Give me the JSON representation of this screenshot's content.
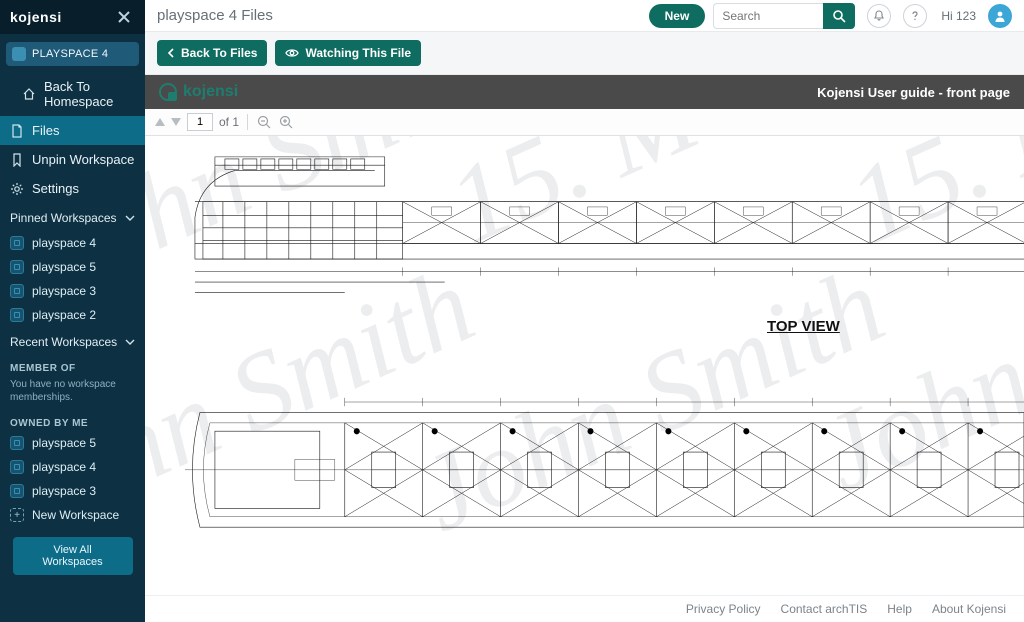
{
  "brand": "kojensi",
  "sidebar": {
    "current_workspace": "PLAYSPACE 4",
    "back_home": "Back To Homespace",
    "nav": {
      "files": "Files",
      "unpin": "Unpin Workspace",
      "settings": "Settings"
    },
    "pinned_title": "Pinned Workspaces",
    "pinned": [
      "playspace 4",
      "playspace 5",
      "playspace 3",
      "playspace 2"
    ],
    "recent_title": "Recent Workspaces",
    "member_of_title": "MEMBER OF",
    "member_note": "You have no workspace memberships.",
    "owned_title": "OWNED BY ME",
    "owned": [
      "playspace 5",
      "playspace 4",
      "playspace 3"
    ],
    "new_ws": "New Workspace",
    "view_all": "View All Workspaces"
  },
  "header": {
    "page_title": "playspace 4 Files",
    "new_label": "New",
    "search_placeholder": "Search",
    "greeting": "Hi 123"
  },
  "toolbar": {
    "back_to_files": "Back To Files",
    "watching": "Watching This File"
  },
  "viewer": {
    "logo_text": "kojensi",
    "doc_title": "Kojensi User guide - front page",
    "page_current": "1",
    "page_of": "of 1",
    "drawing_label": "TOP VIEW",
    "watermark_name": "John Smith"
  },
  "footer": {
    "privacy": "Privacy Policy",
    "contact": "Contact archTIS",
    "help": "Help",
    "about": "About Kojensi"
  }
}
